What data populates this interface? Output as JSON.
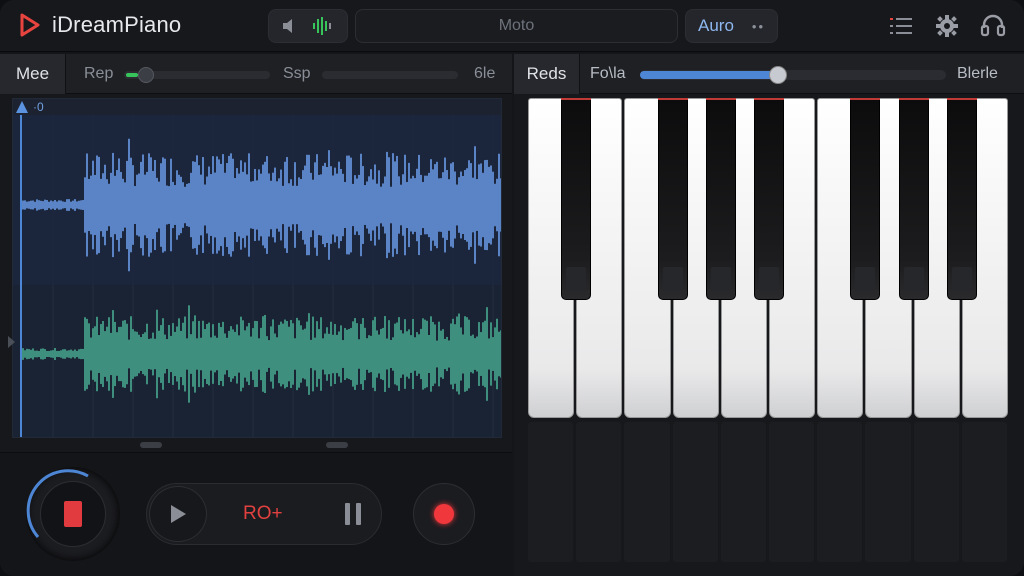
{
  "header": {
    "app_title": "iDreamPiano",
    "center_label": "Moto",
    "mode_label": "Auro",
    "mode_dots": "••"
  },
  "left_panel": {
    "tab_label": "Mee",
    "rep_label": "Rep",
    "ssp_label": "Ssp",
    "end_label": "6le",
    "ruler_label": "·0"
  },
  "transport": {
    "rec_label": "RO+"
  },
  "right_panel": {
    "tab_label": "Reds",
    "slider_label": "Fo\\la",
    "end_label": "Blerle",
    "slider_value": 0.45
  },
  "colors": {
    "accent_blue": "#4d86d4",
    "wave_blue": "#5b84c6",
    "wave_green": "#3f8f7e",
    "record_red": "#f0383c",
    "level_green": "#37c45a"
  }
}
